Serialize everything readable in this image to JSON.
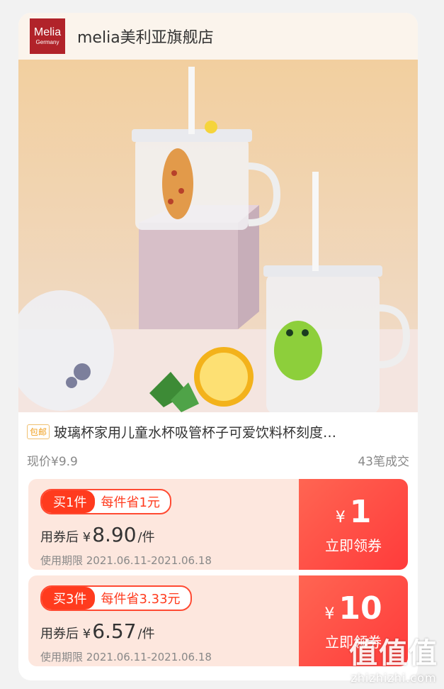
{
  "store": {
    "logo_line1": "Melia",
    "logo_line2": "Germany",
    "name": "melia美利亚旗舰店"
  },
  "hero": {
    "image": "kids glass cups with straws, giraffe and frog print, lemon slice and mint on pastel background"
  },
  "product": {
    "shipping_tag": "包邮",
    "title": "玻璃杯家用儿童水杯吸管杯子可爱饮料杯刻度…",
    "current_price": "现价¥9.9",
    "sales": "43笔成交"
  },
  "coupons": [
    {
      "qty": "买1件",
      "saving": "每件省1元",
      "price_prefix": "用券后 ¥",
      "price": "8.90",
      "unit": "/件",
      "validity": "使用期限 2021.06.11-2021.06.18",
      "currency": "¥",
      "amount": "1",
      "claim": "立即领券"
    },
    {
      "qty": "买3件",
      "saving": "每件省3.33元",
      "price_prefix": "用券后 ¥",
      "price": "6.57",
      "unit": "/件",
      "validity": "使用期限 2021.06.11-2021.06.18",
      "currency": "¥",
      "amount": "10",
      "claim": "立即领券"
    }
  ],
  "watermark": {
    "line1": "值值值",
    "line2": "zhizhizhi.com"
  },
  "colors": {
    "accent": "#ff3b1e",
    "coupon_bg": "#fde7de",
    "logo_bg": "#b1232a"
  }
}
